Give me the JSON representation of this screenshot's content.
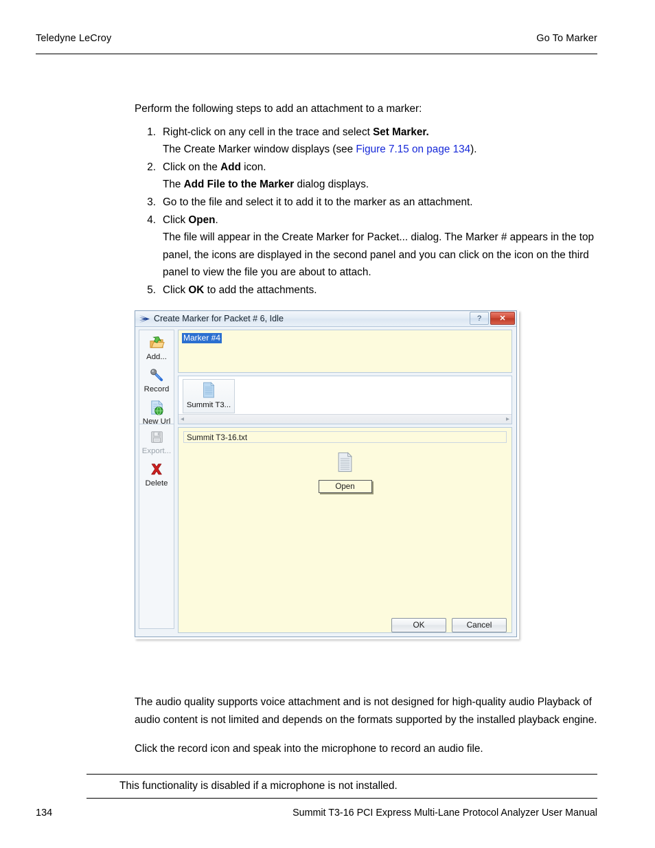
{
  "header": {
    "left": "Teledyne LeCroy",
    "right": "Go To Marker"
  },
  "intro": "Perform the following steps to add an attachment to a marker:",
  "steps": [
    {
      "num": "1.",
      "main_pre": "Right-click on any cell in the trace and select ",
      "main_bold": "Set Marker.",
      "main_post": "",
      "sub_pre": "The Create Marker window displays (see ",
      "sub_link": "Figure 7.15 on page 134",
      "sub_post": ")."
    },
    {
      "num": "2.",
      "main_pre": "Click on the ",
      "main_bold": "Add",
      "main_post": " icon.",
      "sub_pre": "The ",
      "sub_bold": "Add File to the Marker",
      "sub_post": " dialog displays."
    },
    {
      "num": "3.",
      "main_pre": "Go to the file and select it to add it to the marker as an attachment.",
      "main_bold": "",
      "main_post": ""
    },
    {
      "num": "4.",
      "main_pre": "Click ",
      "main_bold": "Open",
      "main_post": ".",
      "sub_para": "The file will appear in the Create Marker for Packet... dialog. The Marker # appears in the top panel, the icons are displayed in the second panel and you can click on the icon on the third panel to view the file you are about to attach."
    },
    {
      "num": "5.",
      "main_pre": "Click ",
      "main_bold": "OK",
      "main_post": " to add the attachments."
    }
  ],
  "dialog": {
    "title": "Create Marker for Packet # 6, Idle",
    "app_icon": "lecroy-chevron-icon",
    "help_button": "?",
    "close_button": "✕",
    "toolbar": {
      "group1": [
        {
          "label": "Add...",
          "icon": "folder-open-green-arrow-icon",
          "disabled": false
        },
        {
          "label": "Record",
          "icon": "microphone-icon",
          "disabled": false
        },
        {
          "label": "New Url",
          "icon": "document-globe-icon",
          "disabled": false
        }
      ],
      "group2": [
        {
          "label": "Export...",
          "icon": "floppy-disk-icon",
          "disabled": true
        },
        {
          "label": "Delete",
          "icon": "red-x-icon",
          "disabled": false
        }
      ]
    },
    "marker_panel": {
      "selected_text": "Marker #4"
    },
    "icons_panel": {
      "tile_caption": "Summit T3...",
      "tile_icon": "text-document-icon",
      "scroll_left": "◂",
      "scroll_right": "▸"
    },
    "preview_panel": {
      "file_name": "Summit T3-16.txt",
      "preview_icon": "text-document-icon",
      "open_label": "Open"
    },
    "footer": {
      "ok_label": "OK",
      "cancel_label": "Cancel"
    }
  },
  "lower": {
    "para1": "The audio quality supports voice attachment and is not designed for high-quality audio Playback of audio content is not limited and depends on the formats supported by the installed playback engine.",
    "para2": "Click the record icon and speak into the microphone to record an audio file."
  },
  "note": "This functionality is disabled if a microphone is not installed.",
  "footer": {
    "page_number": "134",
    "manual_title": "Summit T3-16 PCI Express Multi-Lane Protocol Analyzer User Manual"
  },
  "colors": {
    "link": "#1628d8",
    "selection": "#2b6fd0",
    "panel_yellow": "#fdfbdd",
    "close_red": "#cf4c38"
  }
}
